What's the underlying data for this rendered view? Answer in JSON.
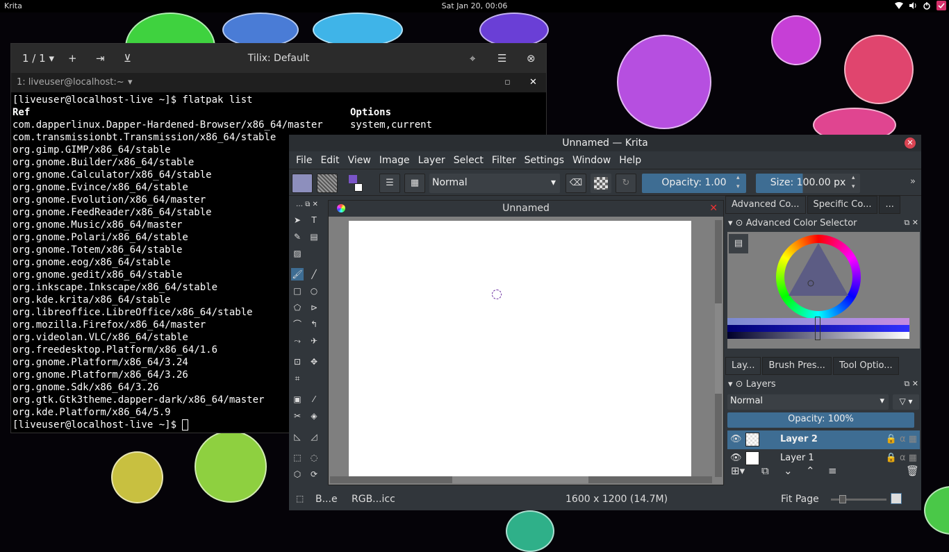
{
  "topbar": {
    "app_name": "Krita",
    "clock": "Sat Jan 20, 00:06",
    "icons": [
      "wifi-icon",
      "volume-icon",
      "power-icon",
      "check-icon"
    ]
  },
  "tilix": {
    "session_counter": "1 / 1",
    "title": "Tilix: Default",
    "session_tab": "1: liveuser@localhost:~",
    "terminal": {
      "prompt_cmd": "[liveuser@localhost-live ~]$ flatpak list",
      "header_ref": "Ref",
      "header_options": "Options",
      "rows": [
        "com.dapperlinux.Dapper-Hardened-Browser/x86_64/master",
        "com.transmissionbt.Transmission/x86_64/stable",
        "org.gimp.GIMP/x86_64/stable",
        "org.gnome.Builder/x86_64/stable",
        "org.gnome.Calculator/x86_64/stable",
        "org.gnome.Evince/x86_64/stable",
        "org.gnome.Evolution/x86_64/master",
        "org.gnome.FeedReader/x86_64/stable",
        "org.gnome.Music/x86_64/master",
        "org.gnome.Polari/x86_64/stable",
        "org.gnome.Totem/x86_64/stable",
        "org.gnome.eog/x86_64/stable",
        "org.gnome.gedit/x86_64/stable",
        "org.inkscape.Inkscape/x86_64/stable",
        "org.kde.krita/x86_64/stable",
        "org.libreoffice.LibreOffice/x86_64/stable",
        "org.mozilla.Firefox/x86_64/master",
        "org.videolan.VLC/x86_64/stable",
        "org.freedesktop.Platform/x86_64/1.6",
        "org.gnome.Platform/x86_64/3.24",
        "org.gnome.Platform/x86_64/3.26",
        "org.gnome.Sdk/x86_64/3.26",
        "org.gtk.Gtk3theme.dapper-dark/x86_64/master",
        "org.kde.Platform/x86_64/5.9"
      ],
      "first_options": "system,current",
      "final_prompt": "[liveuser@localhost-live ~]$ "
    }
  },
  "krita": {
    "title": "Unnamed  — Krita",
    "menu": [
      "File",
      "Edit",
      "View",
      "Image",
      "Layer",
      "Select",
      "Filter",
      "Settings",
      "Window",
      "Help"
    ],
    "blend_mode": "Normal",
    "opacity_label": "Opacity:",
    "opacity_value": "1.00",
    "size_label": "Size:",
    "size_value": "100.00 px",
    "doc_title": "Unnamed",
    "dock_tabs": [
      "Advanced Co...",
      "Specific Co...",
      "..."
    ],
    "color_selector_title": "Advanced Color Selector",
    "bottom_tabs": [
      "Lay...",
      "Brush Pres...",
      "Tool Optio..."
    ],
    "layers_title": "Layers",
    "layers_blend": "Normal",
    "layers_opacity": "Opacity:  100%",
    "layers": [
      "Layer 2",
      "Layer 1"
    ],
    "status": {
      "brush": "B...e",
      "colorspace": "RGB...icc",
      "dimensions": "1600 x 1200 (14.7M)",
      "zoom": "Fit Page"
    }
  }
}
